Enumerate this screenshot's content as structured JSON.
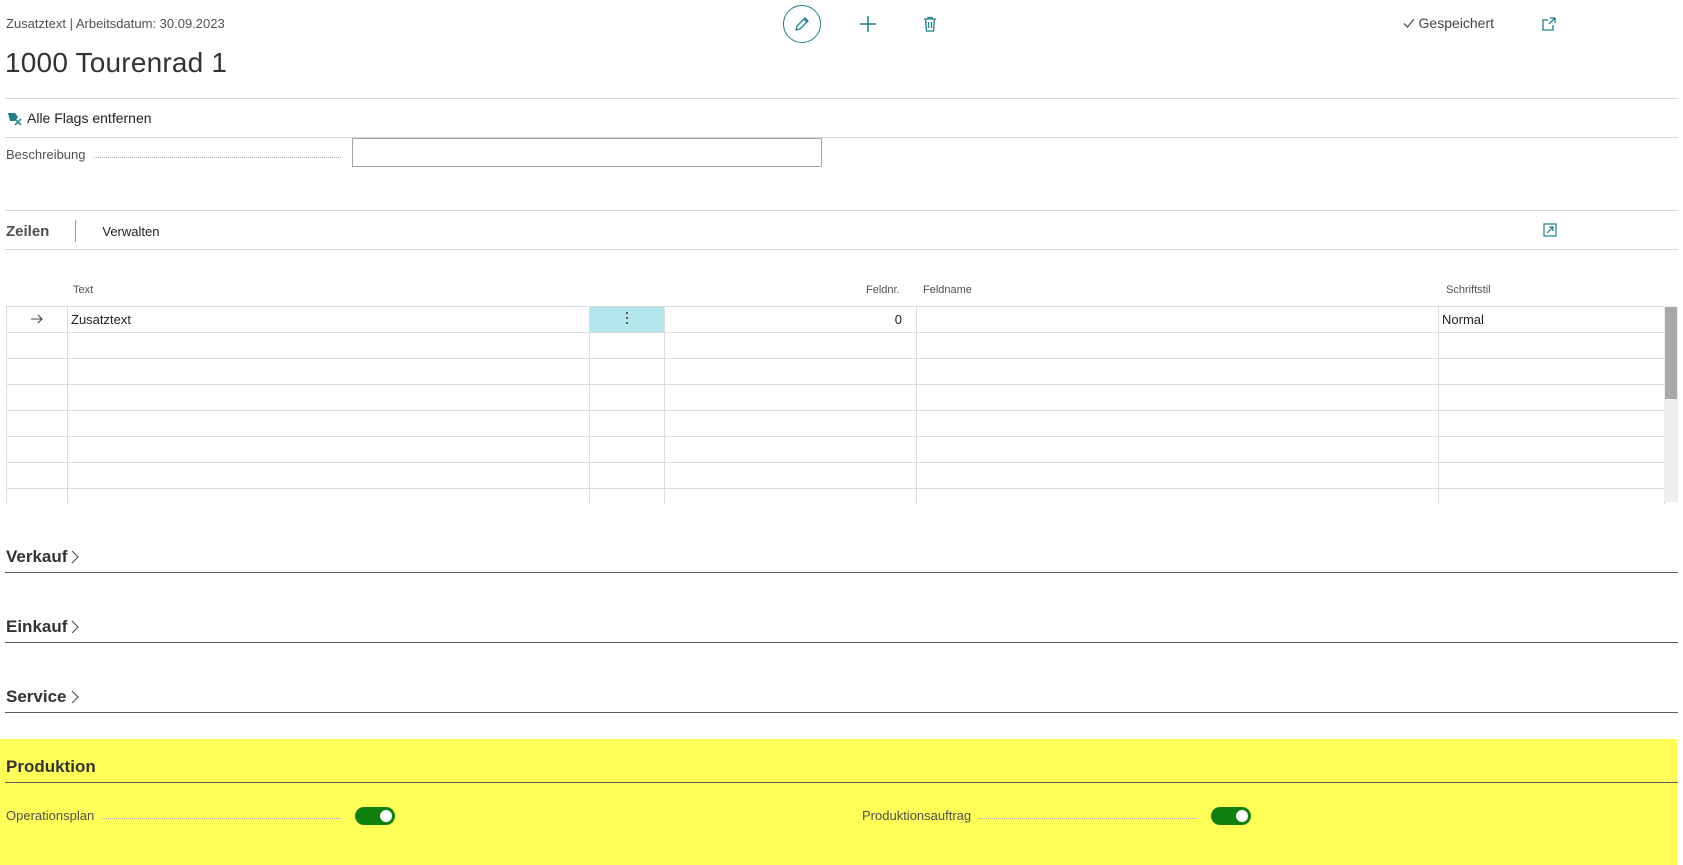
{
  "header": {
    "breadcrumb": "Zusatztext | Arbeitsdatum: 30.09.2023",
    "title": "1000 Tourenrad 1",
    "saved_label": "Gespeichert"
  },
  "actions": {
    "remove_flags": "Alle Flags entfernen"
  },
  "fields": {
    "description_label": "Beschreibung",
    "description_value": ""
  },
  "lines": {
    "tab_label": "Zeilen",
    "manage_label": "Verwalten",
    "columns": {
      "text": "Text",
      "field_no": "Feldnr.",
      "field_name": "Feldname",
      "font_style": "Schriftstil"
    },
    "rows": [
      {
        "text": "Zusatztext",
        "field_no": "0",
        "field_name": "",
        "font_style": "Normal"
      }
    ]
  },
  "sections": {
    "sales": "Verkauf",
    "purchase": "Einkauf",
    "service": "Service",
    "production": "Produktion"
  },
  "production": {
    "routing_label": "Operationsplan",
    "routing_value": true,
    "prod_order_label": "Produktionsauftrag",
    "prod_order_value": true
  },
  "colors": {
    "accent": "#1f7f8a",
    "highlight": "#ffff57",
    "toggle_on": "#0f7f0f",
    "active_cell": "#b2e6ec"
  }
}
